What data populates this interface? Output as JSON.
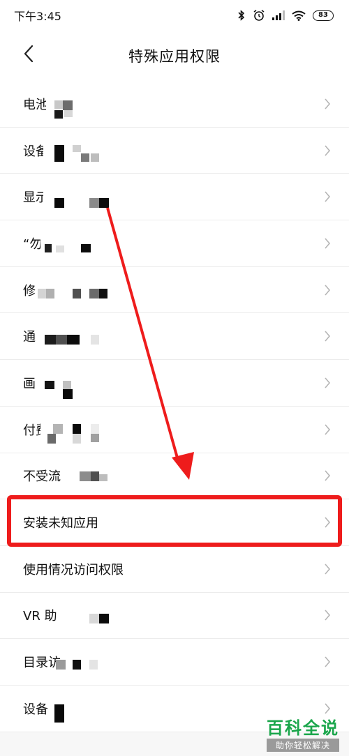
{
  "status_bar": {
    "time": "下午3:45",
    "battery": "83"
  },
  "header": {
    "title": "特殊应用权限",
    "back_icon": "chevron-left-icon"
  },
  "list": {
    "items": [
      {
        "label": "电池"
      },
      {
        "label": "设备"
      },
      {
        "label": "显示                 用的上层"
      },
      {
        "label": "“勿"
      },
      {
        "label": "修"
      },
      {
        "label": "通"
      },
      {
        "label": "画"
      },
      {
        "label": "付费"
      },
      {
        "label": "不受流"
      },
      {
        "label": "安装未知应用"
      },
      {
        "label": "使用情况访问权限"
      },
      {
        "label": "VR 助"
      },
      {
        "label": "目录访"
      },
      {
        "label": "设备"
      }
    ]
  },
  "watermark": {
    "title": "百科全说",
    "subtitle": "助你轻松解决"
  },
  "colors": {
    "highlight": "#ee1c1c",
    "watermark": "#1aa64b"
  }
}
